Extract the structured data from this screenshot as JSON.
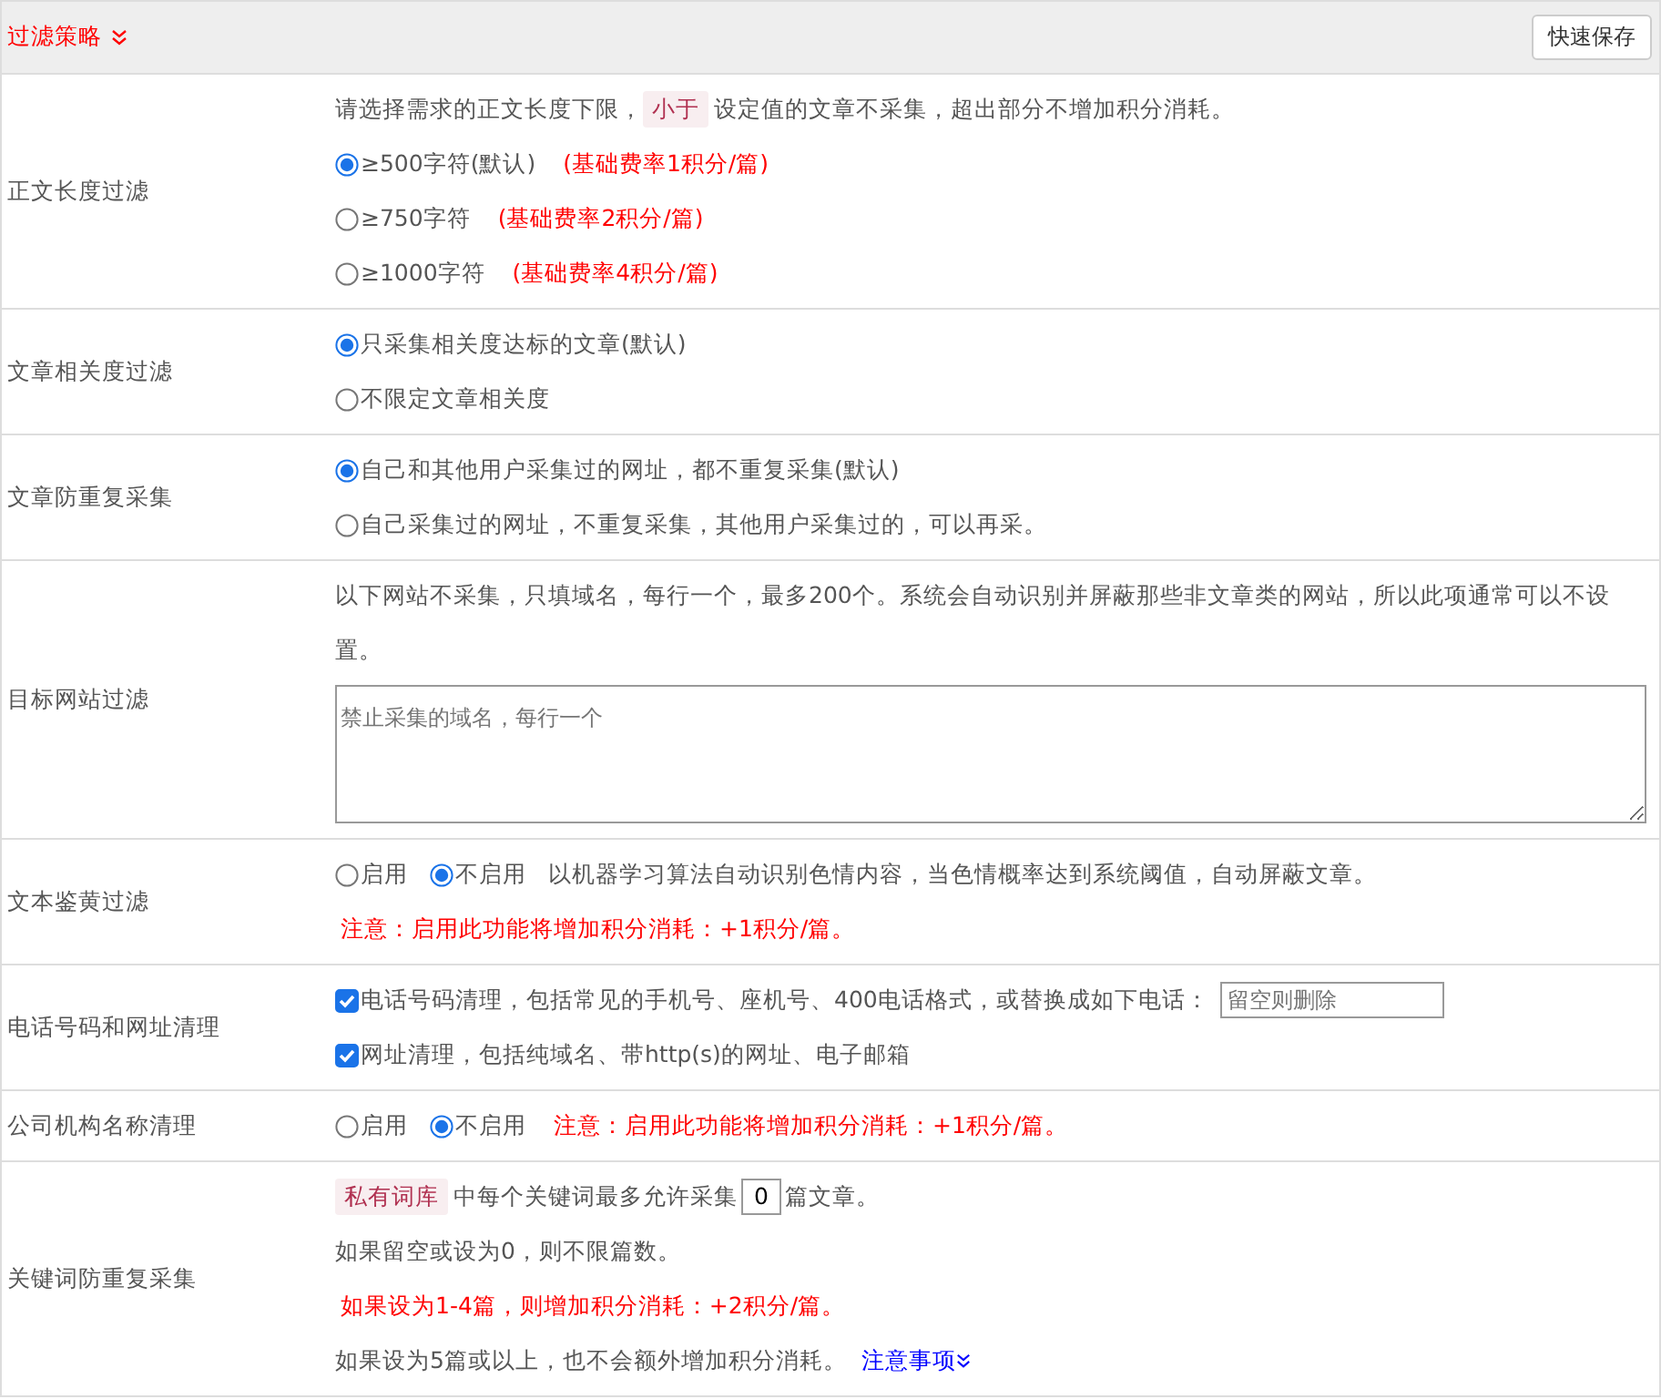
{
  "header": {
    "title": "过滤策略",
    "button": "快速保存"
  },
  "rows": [
    {
      "label": "正文长度过滤",
      "lines": [
        [
          {
            "kind": "text",
            "text": "请选择需求的正文长度下限，"
          },
          {
            "kind": "tag",
            "text": "小于"
          },
          {
            "kind": "text",
            "text": "设定值的文章不采集，超出部分不增加积分消耗。"
          }
        ],
        [
          {
            "kind": "radio",
            "label": "≥500字符(默认)",
            "selected": true
          },
          {
            "kind": "note",
            "text": "(基础费率1积分/篇)"
          }
        ],
        [
          {
            "kind": "radio",
            "label": "≥750字符",
            "selected": false
          },
          {
            "kind": "note",
            "text": "(基础费率2积分/篇)"
          }
        ],
        [
          {
            "kind": "radio",
            "label": "≥1000字符",
            "selected": false
          },
          {
            "kind": "note",
            "text": "(基础费率4积分/篇)"
          }
        ]
      ]
    },
    {
      "label": "文章相关度过滤",
      "lines": [
        [
          {
            "kind": "radio",
            "label": "只采集相关度达标的文章(默认)",
            "selected": true
          }
        ],
        [
          {
            "kind": "radio",
            "label": "不限定文章相关度",
            "selected": false
          }
        ]
      ]
    },
    {
      "label": "文章防重复采集",
      "lines": [
        [
          {
            "kind": "radio",
            "label": "自己和其他用户采集过的网址，都不重复采集(默认)",
            "selected": true
          }
        ],
        [
          {
            "kind": "radio",
            "label": "自己采集过的网址，不重复采集，其他用户采集过的，可以再采。",
            "selected": false
          }
        ]
      ]
    },
    {
      "label": "目标网站过滤",
      "lines": [
        [
          {
            "kind": "text",
            "text": "以下网站不采集，只填域名，每行一个，最多200个。系统会自动识别并屏蔽那些非文章类的网站，所以此项通常可以不设置。"
          }
        ],
        [
          {
            "kind": "textarea",
            "placeholder": "禁止采集的域名，每行一个"
          }
        ]
      ]
    },
    {
      "label": "文本鉴黄过滤",
      "lines": [
        [
          {
            "kind": "radio",
            "label": "启用",
            "selected": false
          },
          {
            "kind": "radio",
            "label": "不启用",
            "selected": true
          },
          {
            "kind": "text",
            "text": "以机器学习算法自动识别色情内容，当色情概率达到系统阈值，自动屏蔽文章。"
          }
        ],
        [
          {
            "kind": "note",
            "text": "注意：启用此功能将增加积分消耗：+1积分/篇。"
          }
        ]
      ]
    },
    {
      "label": "电话号码和网址清理",
      "lines": [
        [
          {
            "kind": "check",
            "label": "电话号码清理，包括常见的手机号、座机号、400电话格式，或替换成如下电话：",
            "checked": true
          },
          {
            "kind": "input",
            "placeholder": "留空则删除"
          }
        ],
        [
          {
            "kind": "check",
            "label": "网址清理，包括纯域名、带http(s)的网址、电子邮箱",
            "checked": true
          }
        ]
      ]
    },
    {
      "label": "公司机构名称清理",
      "lines": [
        [
          {
            "kind": "radio",
            "label": "启用",
            "selected": false
          },
          {
            "kind": "radio",
            "label": "不启用",
            "selected": true
          },
          {
            "kind": "note",
            "text": "注意：启用此功能将增加积分消耗：+1积分/篇。"
          }
        ]
      ]
    },
    {
      "label": "关键词防重复采集",
      "lines": [
        [
          {
            "kind": "tag",
            "text": "私有词库"
          },
          {
            "kind": "text",
            "text": "中每个关键词最多允许采集"
          },
          {
            "kind": "number",
            "value": "0"
          },
          {
            "kind": "text",
            "text": "篇文章。"
          }
        ],
        [
          {
            "kind": "text",
            "text": "如果留空或设为0，则不限篇数。"
          }
        ],
        [
          {
            "kind": "note",
            "text": "如果设为1-4篇，则增加积分消耗：+2积分/篇。"
          }
        ],
        [
          {
            "kind": "text",
            "text": "如果设为5篇或以上，也不会额外增加积分消耗。"
          },
          {
            "kind": "link",
            "text": "注意事项"
          }
        ]
      ]
    }
  ]
}
